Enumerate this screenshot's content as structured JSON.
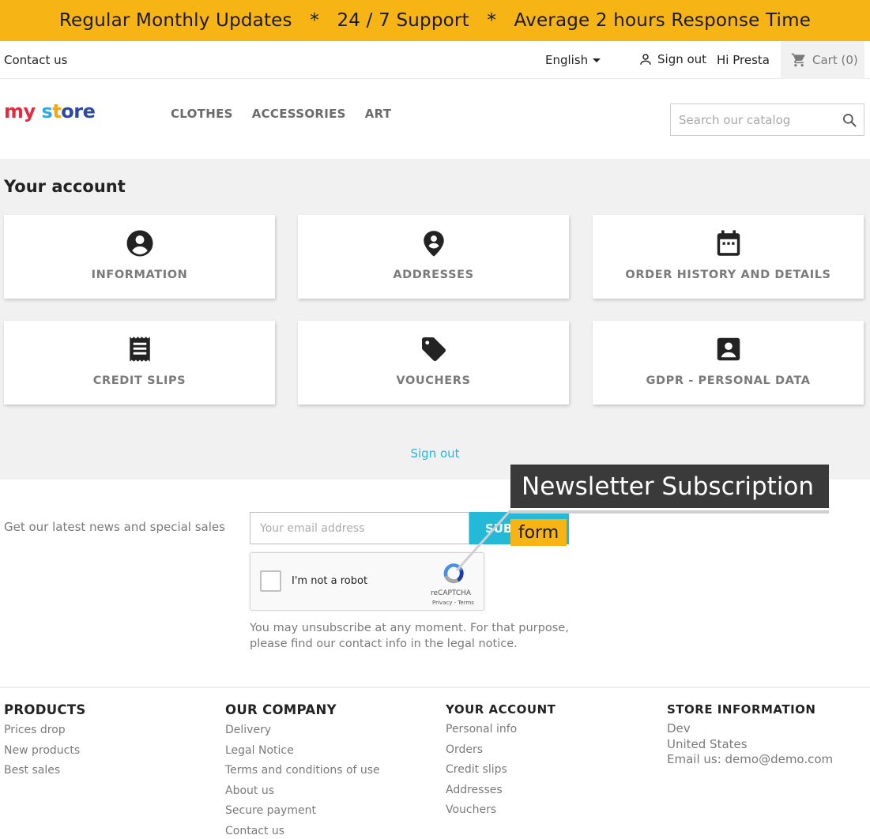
{
  "banner": {
    "text": "Regular Monthly Updates   *   24 / 7 Support   *   Average 2 hours Response Time"
  },
  "topnav": {
    "contact": "Contact us",
    "language": "English",
    "signout": "Sign out",
    "greeting": "Hi Presta",
    "cart": "Cart (0)"
  },
  "header": {
    "logo": [
      "my",
      " s",
      "t",
      "ore"
    ],
    "menu": [
      "CLOTHES",
      "ACCESSORIES",
      "ART"
    ],
    "search_placeholder": "Search our catalog"
  },
  "account": {
    "title": "Your account",
    "tiles": [
      {
        "label": "INFORMATION",
        "icon": "account-circle-icon"
      },
      {
        "label": "ADDRESSES",
        "icon": "location-pin-icon"
      },
      {
        "label": "ORDER HISTORY AND DETAILS",
        "icon": "calendar-icon"
      },
      {
        "label": "CREDIT SLIPS",
        "icon": "receipt-icon"
      },
      {
        "label": "VOUCHERS",
        "icon": "tag-icon"
      },
      {
        "label": "GDPR - PERSONAL DATA",
        "icon": "account-box-icon"
      }
    ],
    "signout": "Sign out"
  },
  "newsletter": {
    "lead": "Get our latest news and special sales",
    "email_placeholder": "Your email address",
    "button": "SUB",
    "captcha_label": "I'm not a robot",
    "captcha_brand": "reCAPTCHA",
    "captcha_terms": "Privacy - Terms",
    "note_1": "You may unsubscribe at any moment. For that purpose,",
    "note_2": "please find our contact info in the legal notice."
  },
  "callout": {
    "title": "Newsletter Subscription",
    "tag": "form"
  },
  "footer": {
    "products": {
      "title": "PRODUCTS",
      "items": [
        "Prices drop",
        "New products",
        "Best sales"
      ]
    },
    "company": {
      "title": "OUR COMPANY",
      "items": [
        "Delivery",
        "Legal Notice",
        "Terms and conditions of use",
        "About us",
        "Secure payment",
        "Contact us"
      ]
    },
    "your_account": {
      "title": "YOUR ACCOUNT",
      "items": [
        "Personal info",
        "Orders",
        "Credit slips",
        "Addresses",
        "Vouchers"
      ]
    },
    "store": {
      "title": "STORE INFORMATION",
      "lines": [
        "Dev",
        "United States",
        "Email us: demo@demo.com"
      ]
    }
  },
  "colors": {
    "banner": "#f6b514",
    "accent": "#24b9d7",
    "callout_dark": "#3a3a3a"
  }
}
